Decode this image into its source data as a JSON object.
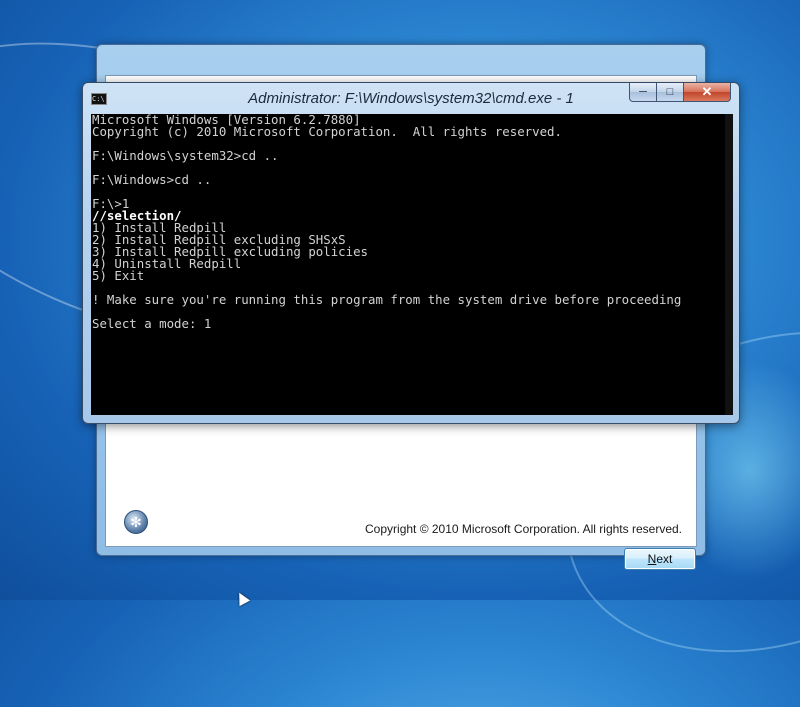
{
  "setup": {
    "copyright": "Copyright © 2010 Microsoft Corporation.  All rights reserved.",
    "next_label": "Next",
    "next_underline": "N",
    "next_rest": "ext"
  },
  "cmd": {
    "title": "Administrator: F:\\Windows\\system32\\cmd.exe - 1",
    "lines": [
      "Microsoft Windows [Version 6.2.7880]",
      "Copyright (c) 2010 Microsoft Corporation.  All rights reserved.",
      "",
      "F:\\Windows\\system32>cd ..",
      "",
      "F:\\Windows>cd ..",
      "",
      "F:\\>1",
      "//selection/",
      "1) Install Redpill",
      "2) Install Redpill excluding SHSxS",
      "3) Install Redpill excluding policies",
      "4) Uninstall Redpill",
      "5) Exit",
      "",
      "! Make sure you're running this program from the system drive before proceeding",
      "",
      "Select a mode: 1"
    ]
  },
  "icons": {
    "cmd": "cmd-icon",
    "minimize": "minimize-icon",
    "maximize": "maximize-icon",
    "close": "close-icon",
    "setup_logo": "setup-logo-icon"
  }
}
